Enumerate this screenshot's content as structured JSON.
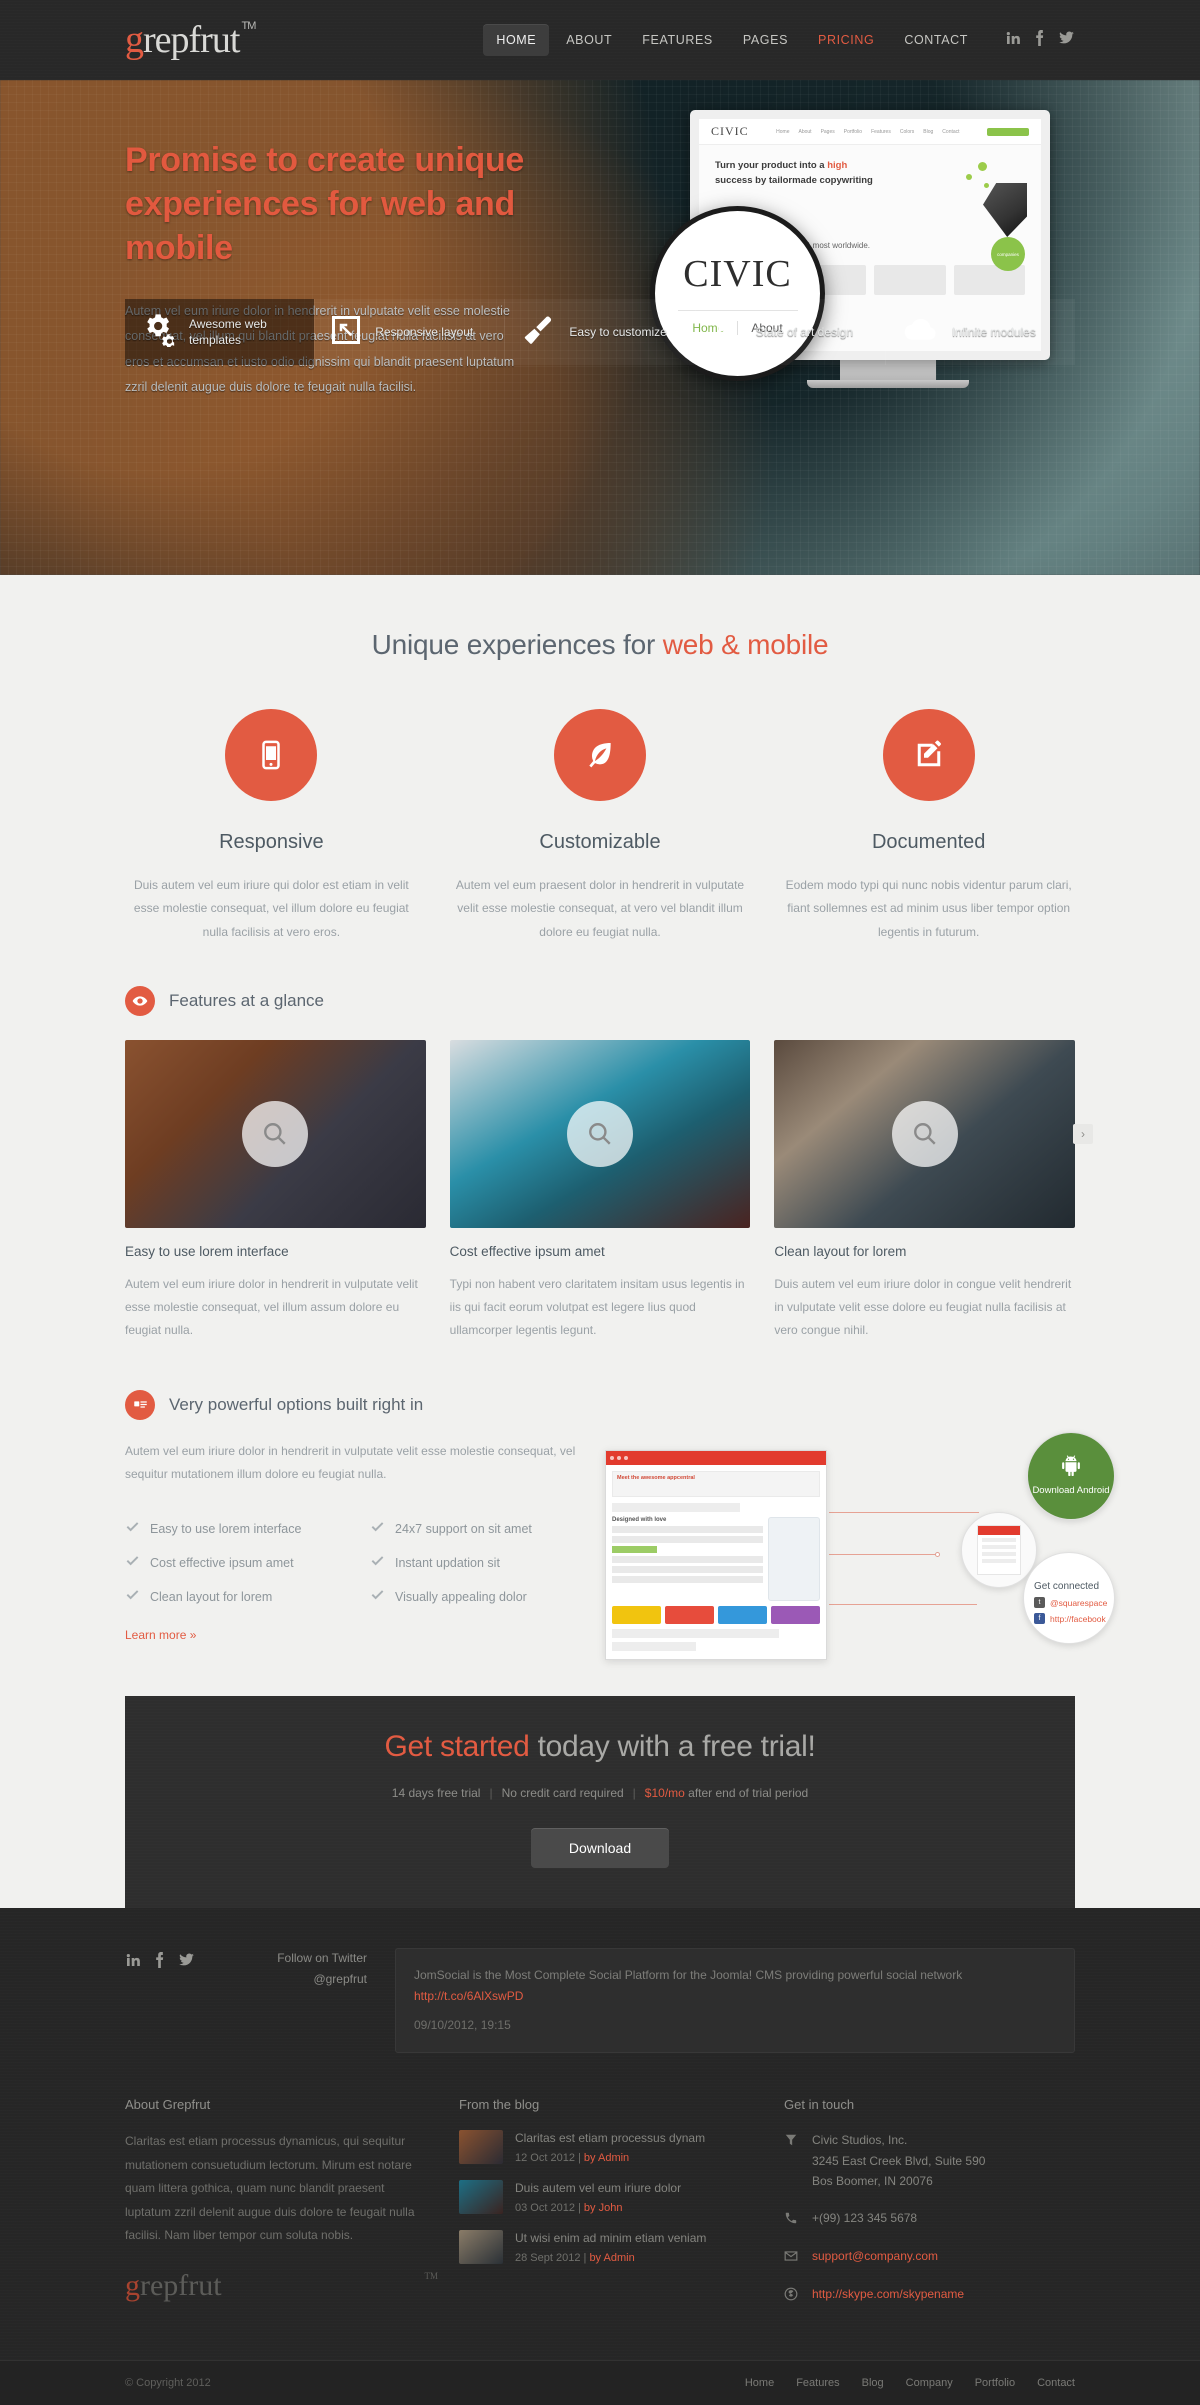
{
  "header": {
    "logo": {
      "accent": "g",
      "rest": "repfrut",
      "tm": "TM"
    },
    "nav": [
      {
        "label": "HOME",
        "state": "active"
      },
      {
        "label": "ABOUT",
        "state": ""
      },
      {
        "label": "FEATURES",
        "state": ""
      },
      {
        "label": "PAGES",
        "state": ""
      },
      {
        "label": "PRICING",
        "state": "accent"
      },
      {
        "label": "CONTACT",
        "state": ""
      }
    ],
    "socials": [
      "linkedin-icon",
      "facebook-icon",
      "twitter-icon"
    ]
  },
  "hero": {
    "title": "Promise to create unique experiences for web and mobile",
    "body": "Autem vel eum iriure dolor in hendrerit in vulputate velit esse molestie consequat, vel illum qui blandit praesent feugiat nulla facilisis at vero eros et accumsan et iusto odio dignissim qui blandit praesent luptatum zzril delenit augue duis dolore te feugait nulla facilisi.",
    "monitor": {
      "brand": "CIVIC",
      "nav": [
        "Home",
        "About",
        "Pages",
        "Portfolio",
        "Features",
        "Colors",
        "Blog",
        "Contact"
      ],
      "headline_1": "Turn your product into a ",
      "headline_strong": "high",
      "headline_2": " success by tailormade copywriting",
      "badge": "companies",
      "body": "We make civic awesome & most worldwide."
    },
    "magnifier": {
      "word_a": "CI",
      "word_b": "V",
      "word_c": "IC",
      "tab_active": "Home",
      "tab": "About"
    },
    "features": [
      {
        "icon": "gears-icon",
        "label": "Awesome web templates"
      },
      {
        "icon": "resize-icon",
        "label": "Responsive layout"
      },
      {
        "icon": "brush-icon",
        "label": "Easy to customize"
      },
      {
        "icon": "flag-icon",
        "label": "State of art design"
      },
      {
        "icon": "cloud-icon",
        "label": "Infinite modules"
      }
    ]
  },
  "services": {
    "title_plain": "Unique experiences for ",
    "title_accent": "web & mobile",
    "items": [
      {
        "icon": "mobile-icon",
        "title": "Responsive",
        "text": "Duis autem vel eum iriure qui dolor est etiam in velit esse molestie consequat, vel illum dolore eu feugiat nulla facilisis at vero eros."
      },
      {
        "icon": "leaf-icon",
        "title": "Customizable",
        "text": "Autem vel eum praesent dolor in hendrerit in vulputate velit esse molestie consequat, at vero vel blandit illum dolore eu feugiat nulla."
      },
      {
        "icon": "pencil-square-icon",
        "title": "Documented",
        "text": "Eodem modo typi qui nunc nobis videntur parum clari, fiant sollemnes est ad minim usus liber tempor option legentis in futurum."
      }
    ]
  },
  "glance": {
    "heading": "Features at a glance",
    "next_label": "›",
    "items": [
      {
        "title": "Easy to use lorem interface",
        "text": "Autem vel eum iriure dolor in hendrerit in vulputate velit esse molestie consequat, vel illum assum dolore eu feugiat nulla."
      },
      {
        "title": "Cost effective ipsum amet",
        "text": "Typi non habent vero claritatem insitam usus legentis in iis qui facit eorum volutpat est legere lius quod ullamcorper legentis legunt."
      },
      {
        "title": "Clean layout for lorem",
        "text": "Duis autem vel eum iriure dolor in congue velit hendrerit in vulputate velit esse dolore eu feugiat nulla facilisis at vero congue nihil."
      }
    ]
  },
  "power": {
    "heading": "Very powerful options built right in",
    "text": "Autem vel eum iriure dolor in hendrerit in vulputate velit esse molestie consequat, vel sequitur mutationem illum dolore eu feugiat nulla.",
    "checks": [
      "Easy to use lorem interface",
      "24x7 support on sit amet",
      "Cost effective ipsum amet",
      "Instant updation sit",
      "Clean layout for lorem",
      "Visually appealing dolor"
    ],
    "learn_more": "Learn more »",
    "art": {
      "browser_title": "Meet the awesome appcentral",
      "browser_sub": "Designed with love",
      "android_label": "Download Android",
      "social_title": "Get connected",
      "social_twitter": "@squarespace",
      "social_facebook": "http://facebook"
    }
  },
  "cta": {
    "title_accent": "Get started",
    "title_plain": " today with a free trial!",
    "point_1": "14 days free trial",
    "point_2": "No credit card required",
    "price": "$10/mo",
    "point_3": " after end of trial period",
    "button": "Download"
  },
  "footer": {
    "socials": [
      "linkedin-icon",
      "facebook-icon",
      "twitter-icon"
    ],
    "follow_line1": "Follow on Twitter",
    "follow_line2": "@grepfrut",
    "tweet": {
      "text_1": "JomSocial is the Most Complete Social Platform for the Joomla! CMS providing powerful social network ",
      "link": "http://t.co/6AlXswPD",
      "date": "09/10/2012, 19:15"
    },
    "about": {
      "title": "About Grepfrut",
      "text": "Claritas est etiam processus dynamicus, qui sequitur mutationem consuetudium lectorum. Mirum est notare quam littera gothica, quam nunc blandit praesent luptatum zzril delenit augue duis dolore te feugait nulla facilisi. Nam liber tempor cum soluta nobis.",
      "logo_g": "g",
      "logo_rest": "repfrut",
      "logo_tm": "TM"
    },
    "blog": {
      "title": "From the blog",
      "posts": [
        {
          "title": "Claritas est etiam processus dynam",
          "date": "12 Oct 2012",
          "sep": " | ",
          "by": "by Admin"
        },
        {
          "title": "Duis autem vel eum iriure dolor",
          "date": "03 Oct 2012",
          "sep": " | ",
          "by": "by John"
        },
        {
          "title": "Ut wisi enim ad minim etiam veniam",
          "date": "28 Sept 2012",
          "sep": " | ",
          "by": "by Admin"
        }
      ]
    },
    "contact": {
      "title": "Get in touch",
      "address": "Civic Studios, Inc.\n3245 East Creek Blvd, Suite 590\nBos Boomer, IN 20076",
      "phone": "+(99) 123 345 5678",
      "email": "support@company.com",
      "skype": "http://skype.com/skypename"
    },
    "bottom": {
      "copyright": "© Copyright 2012",
      "links": [
        "Home",
        "Features",
        "Blog",
        "Company",
        "Portfolio",
        "Contact"
      ]
    }
  },
  "colors": {
    "accent": "#e25b42",
    "dark": "#282828",
    "body_bg": "#f1f1ef"
  }
}
